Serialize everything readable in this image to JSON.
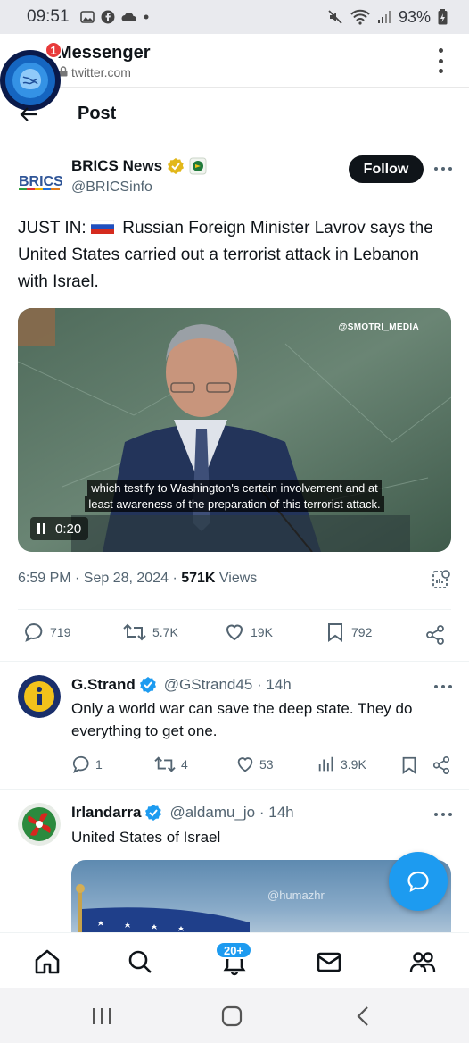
{
  "status_bar": {
    "time": "09:51",
    "battery": "93%"
  },
  "browser": {
    "app_title": "Messenger",
    "url": "twitter.com",
    "chathead_badge": "1"
  },
  "post_header": {
    "title": "Post"
  },
  "tweet": {
    "author_name": "BRICS News",
    "author_handle": "@BRICSinfo",
    "avatar_text": "BRICS",
    "follow_label": "Follow",
    "text": "JUST IN: 🇷🇺 Russian Foreign Minister Lavrov says the United States carried out a terrorist attack in Lebanon with Israel.",
    "text_prefix": "JUST IN:",
    "text_body": "Russian Foreign Minister Lavrov says the United States carried out a terrorist attack in Lebanon with Israel.",
    "video": {
      "watermark": "@SMOTRI_MEDIA",
      "subtitle_line1": "which testify to Washington's certain involvement and at",
      "subtitle_line2": "least awareness of the preparation of this terrorist attack.",
      "time": "0:20"
    },
    "timestamp": "6:59 PM · Sep 28, 2024 · ",
    "views_count": "571K",
    "views_label": " Views",
    "stats": {
      "replies": "719",
      "reposts": "5.7K",
      "likes": "19K",
      "bookmarks": "792"
    }
  },
  "replies": [
    {
      "name": "G.Strand",
      "handle": "@GStrand45 · 14h",
      "text": "Only a world war can save the deep state. They do everything to get one.",
      "replies": "1",
      "reposts": "4",
      "likes": "53",
      "views": "3.9K"
    },
    {
      "name": "Irlandarra",
      "handle": "@aldamu_jo · 14h",
      "text": "United States of Israel",
      "media_watermark": "@humazhr"
    }
  ],
  "bottom_nav": {
    "notifications_badge": "20+"
  },
  "colors": {
    "accent": "#1d9bf0",
    "text": "#0f1419",
    "muted": "#536471",
    "verified_gold": "#e2b719"
  }
}
